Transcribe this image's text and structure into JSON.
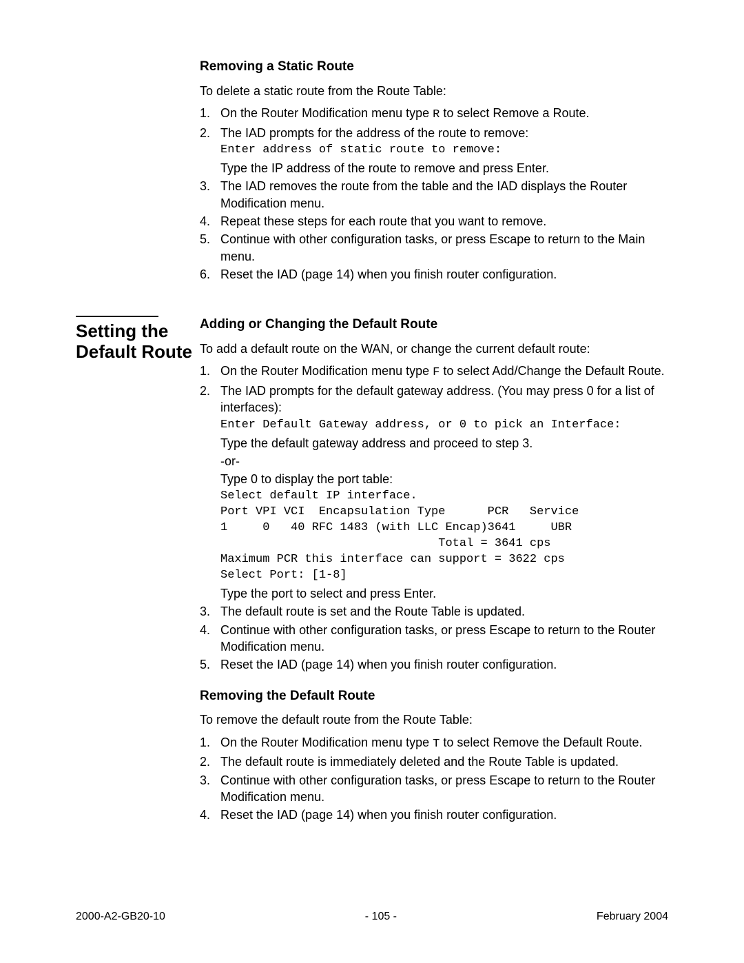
{
  "section1": {
    "heading": "Removing a Static Route",
    "intro": "To delete a static route from the Route Table:",
    "step1_a": "On the Router Modification menu type ",
    "step1_code": "R",
    "step1_b": " to select Remove a Route.",
    "step2_a": "The IAD prompts for the address of the route to remove:",
    "step2_mono": "Enter address of static route to remove:",
    "step2_b": "Type the IP address of the route to remove and press Enter.",
    "step3": "The IAD removes the route from the table and the IAD displays the Router Modification menu.",
    "step4": "Repeat these steps for each route that you want to remove.",
    "step5": "Continue with other configuration tasks, or press Escape to return to the Main menu.",
    "step6": "Reset the IAD (page 14) when you finish router configuration."
  },
  "sidebar_title": "Setting the Default Route",
  "section2": {
    "heading": "Adding or Changing the Default Route",
    "intro": "To add a default route on the WAN, or change the current default route:",
    "step1_a": "On the Router Modification menu type ",
    "step1_code": "F",
    "step1_b": " to select Add/Change the Default Route.",
    "step2_a": "The IAD prompts for the default gateway address. (You may press 0 for a list of interfaces):",
    "step2_mono1": "Enter Default Gateway address, or 0 to pick an Interface:",
    "step2_b": "Type the default gateway address and proceed to step 3.",
    "step2_or": "-or-",
    "step2_c": "Type 0 to display the port table:",
    "step2_mono2": "Select default IP interface.\nPort VPI VCI  Encapsulation Type      PCR   Service\n1     0   40 RFC 1483 (with LLC Encap)3641     UBR\n                               Total = 3641 cps\nMaximum PCR this interface can support = 3622 cps\nSelect Port: [1-8]",
    "step2_d": "Type the port to select and press Enter.",
    "step3": "The default route is set and the Route Table is updated.",
    "step4": "Continue with other configuration tasks, or press Escape to return to the Router Modification menu.",
    "step5": "Reset the IAD (page 14) when you finish router configuration."
  },
  "section3": {
    "heading": "Removing the Default Route",
    "intro": "To remove the default route from the Route Table:",
    "step1_a": "On the Router Modification menu type ",
    "step1_code": "T",
    "step1_b": " to select Remove the Default Route.",
    "step2": "The default route is immediately deleted and the Route Table is updated.",
    "step3": "Continue with other configuration tasks, or press Escape to return to the Router Modification menu.",
    "step4": "Reset the IAD (page 14) when you finish router configuration."
  },
  "footer": {
    "left": "2000-A2-GB20-10",
    "center": "- 105 -",
    "right": "February 2004"
  }
}
